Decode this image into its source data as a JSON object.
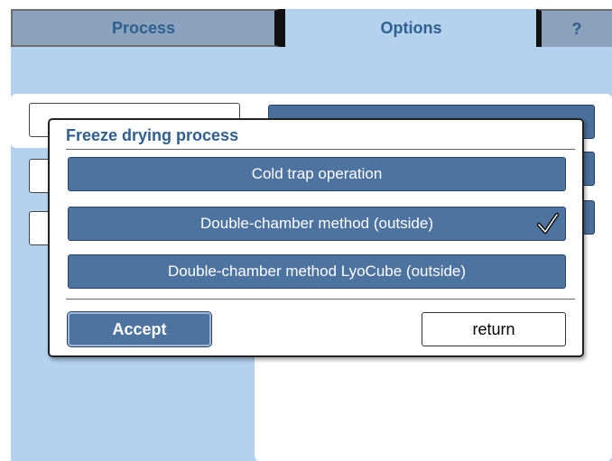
{
  "tabs": [
    {
      "label": "Process"
    },
    {
      "label": "Options"
    },
    {
      "label": "?"
    }
  ],
  "dialog": {
    "title": "Freeze drying process",
    "options": [
      {
        "label": "Cold trap operation",
        "selected": false
      },
      {
        "label": "Double-chamber method (outside)",
        "selected": true
      },
      {
        "label": "Double-chamber method LyoCube (outside)",
        "selected": false
      }
    ],
    "accept_label": "Accept",
    "return_label": "return"
  },
  "colors": {
    "screen_bg": "#b4d1ee",
    "button_blue": "#4d73a1",
    "title_blue": "#2f5f8e"
  }
}
